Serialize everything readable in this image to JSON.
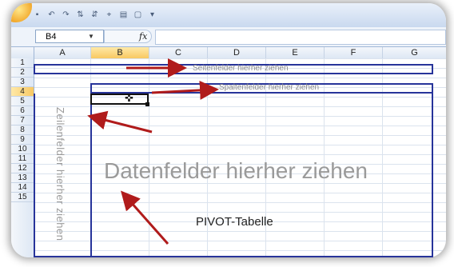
{
  "namebox": {
    "value": "B4"
  },
  "formula": {
    "fx_label": "fx",
    "value": ""
  },
  "columns": [
    "A",
    "B",
    "C",
    "D",
    "E",
    "F",
    "G"
  ],
  "rows": [
    "1",
    "2",
    "3",
    "4",
    "5",
    "6",
    "7",
    "8",
    "9",
    "10",
    "11",
    "12",
    "13",
    "14",
    "15"
  ],
  "selected_cell": {
    "column": "B",
    "row": "4"
  },
  "hints": {
    "page_fields": "Seitenfelder hierher ziehen",
    "column_fields": "Spaltenfelder hierher ziehen",
    "row_fields": "Zeilenfelder hierher ziehen",
    "data_fields": "Datenfelder hierher ziehen"
  },
  "annotation": "PIVOT-Tabelle",
  "colors": {
    "arrow": "#b01b1b",
    "drop_border": "#27349a",
    "selection": "#f8c862"
  },
  "icons": [
    "save-icon",
    "undo-icon",
    "redo-icon",
    "sort-asc-icon",
    "sort-desc-icon",
    "filter-icon",
    "print-preview-icon",
    "customize-icon"
  ]
}
